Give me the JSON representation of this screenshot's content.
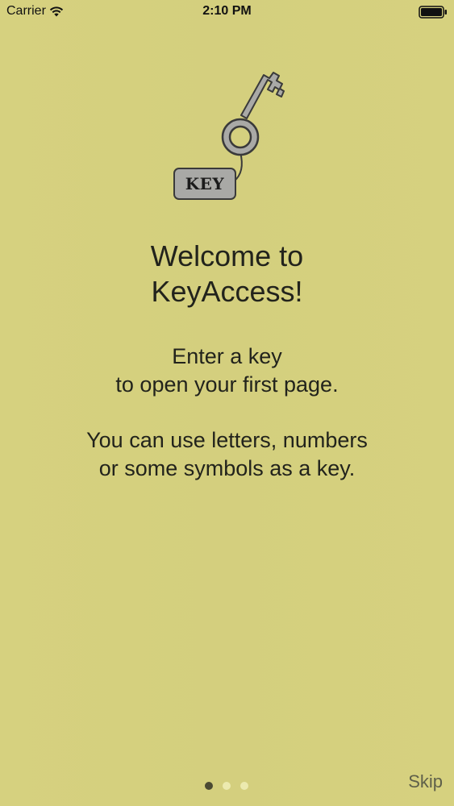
{
  "status_bar": {
    "carrier": "Carrier",
    "time": "2:10 PM",
    "battery_icon": "battery-full-icon",
    "wifi_icon": "wifi-icon"
  },
  "illustration": {
    "icon": "key-icon",
    "tag_label": "KEY"
  },
  "welcome": {
    "title_line1": "Welcome to",
    "title_line2": "KeyAccess!"
  },
  "instructions": {
    "line1": "Enter a key",
    "line2": "to open your first page.",
    "line3": "You can use letters, numbers",
    "line4": "or some symbols as a key."
  },
  "pager": {
    "total": 3,
    "current": 1
  },
  "skip_label": "Skip",
  "colors": {
    "background": "#d5d07f",
    "text": "#22231c",
    "dot_active": "#4b4a33",
    "dot_inactive": "#eceaaf",
    "key_fill": "#a9a9a6",
    "key_stroke": "#3a3a3a"
  }
}
